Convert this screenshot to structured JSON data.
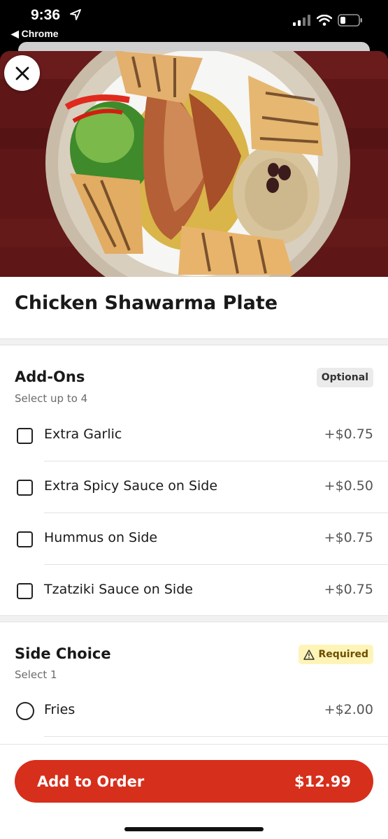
{
  "status": {
    "time": "9:36",
    "back_app": "◀ Chrome"
  },
  "item": {
    "title": "Chicken Shawarma Plate"
  },
  "addons": {
    "title": "Add-Ons",
    "subtitle": "Select up to 4",
    "badge": "Optional",
    "options": [
      {
        "label": "Extra Garlic",
        "price": "+$0.75"
      },
      {
        "label": "Extra Spicy Sauce on Side",
        "price": "+$0.50"
      },
      {
        "label": "Hummus on Side",
        "price": "+$0.75"
      },
      {
        "label": "Tzatziki Sauce on Side",
        "price": "+$0.75"
      }
    ]
  },
  "side_choice": {
    "title": "Side Choice",
    "subtitle": "Select 1",
    "badge": "Required",
    "options": [
      {
        "label": "Fries",
        "price": "+$2.00"
      }
    ]
  },
  "footer": {
    "button_label": "Add to Order",
    "total": "$12.99",
    "accent_color": "#d62f1c"
  }
}
